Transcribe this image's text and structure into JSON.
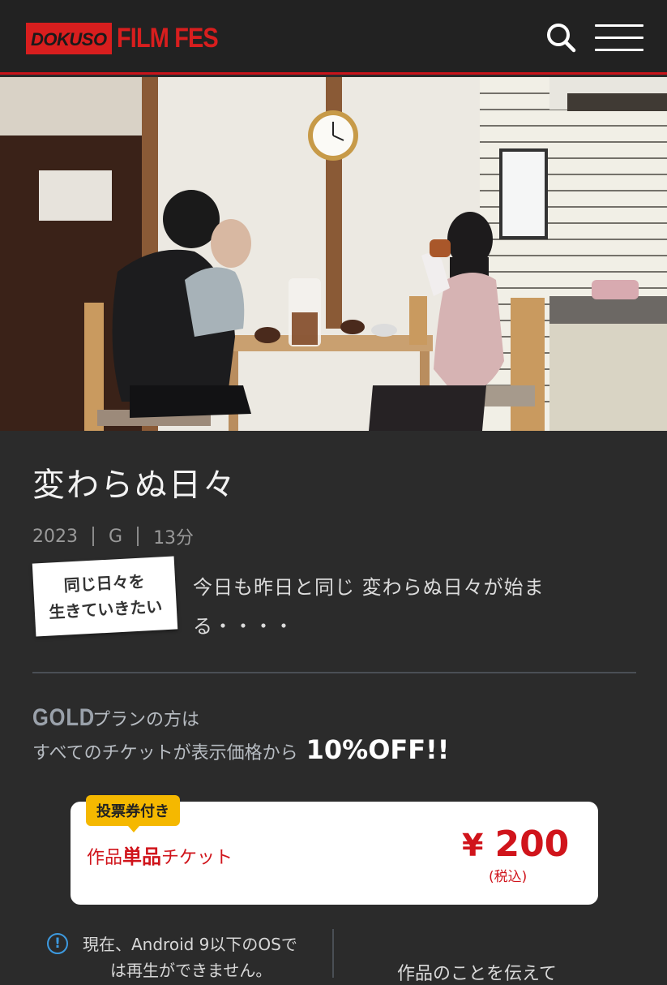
{
  "header": {
    "logo_dokuso": "DOKUSO",
    "logo_filmfes": "FILM FES",
    "search_icon": "search-icon",
    "menu_icon": "hamburger-menu-icon"
  },
  "colors": {
    "brand_red": "#d81e1e",
    "background": "#2b2b2b",
    "header_bg": "#222222",
    "badge_yellow": "#f5b800",
    "price_red": "#d0141b",
    "info_blue": "#3d9ae0"
  },
  "film": {
    "title": "変わらぬ日々",
    "year": "2023",
    "rating": "G",
    "duration": "13分",
    "tag_line1": "同じ日々を",
    "tag_line2": "生きていきたい",
    "synopsis": "今日も昨日と同じ 変わらぬ日々が始まる・・・・"
  },
  "gold": {
    "label": "GOLD",
    "line1": "プランの方は",
    "line2": "すべてのチケットが表示価格から",
    "discount": "10%OFF!!"
  },
  "ticket": {
    "badge": "投票券付き",
    "name_prefix": "作品",
    "name_strong": "単品",
    "name_suffix": "チケット",
    "currency": "¥",
    "price": "200",
    "tax_note": "(税込)"
  },
  "notice": {
    "line1": "現在、Android 9以下のOSで",
    "line2": "は再生ができません。",
    "icon": "info-icon"
  },
  "support_link": "作品のことを伝えて"
}
